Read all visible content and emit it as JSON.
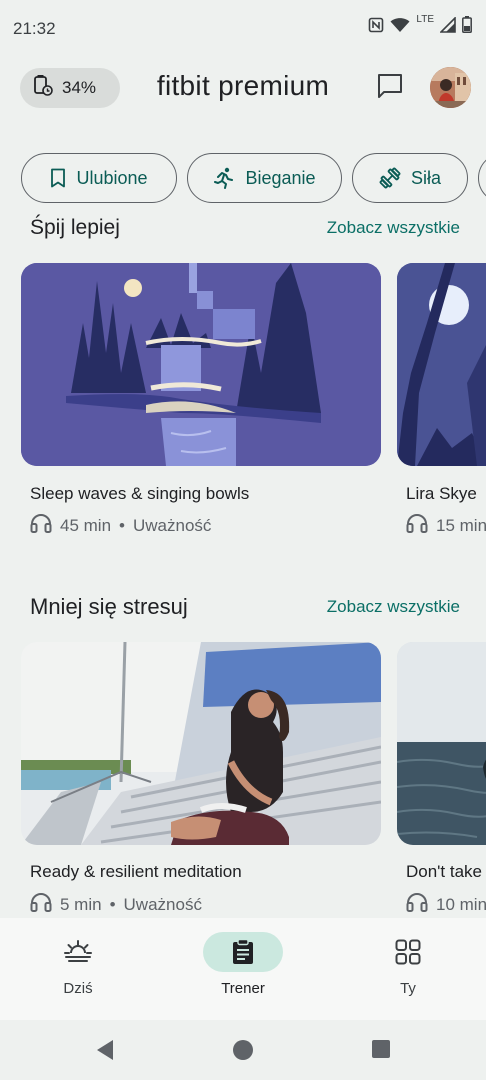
{
  "status_bar": {
    "time": "21:32",
    "network": "LTE",
    "icons": [
      "nfc-icon",
      "wifi-icon",
      "signal-icon",
      "battery-icon"
    ]
  },
  "header": {
    "battery_label": "34%",
    "title": "fitbit premium",
    "icons": [
      "watch-battery-icon",
      "chat-icon",
      "avatar"
    ]
  },
  "chips": [
    {
      "label": "Ulubione",
      "icon": "bookmark-icon"
    },
    {
      "label": "Bieganie",
      "icon": "running-icon"
    },
    {
      "label": "Siła",
      "icon": "dumbbell-icon"
    }
  ],
  "section_sleep": {
    "title": "Śpij lepiej",
    "see_all": "Zobacz wszystkie",
    "cards": [
      {
        "title": "Sleep waves & singing bowls",
        "duration": "45 min",
        "category": "Uważność"
      },
      {
        "title": "Lira Skye",
        "duration": "15 min",
        "category": ""
      }
    ]
  },
  "section_stress": {
    "title": "Mniej się stresuj",
    "see_all": "Zobacz wszystkie",
    "cards": [
      {
        "title": "Ready & resilient meditation",
        "duration": "5 min",
        "category": "Uważność"
      },
      {
        "title": "Don't take",
        "duration": "10 min",
        "category": ""
      }
    ]
  },
  "bottom_nav": {
    "items": [
      {
        "label": "Dziś",
        "icon": "sunrise-icon",
        "active": false
      },
      {
        "label": "Trener",
        "icon": "clipboard-icon",
        "active": true
      },
      {
        "label": "Ty",
        "icon": "grid-icon",
        "active": false
      }
    ]
  },
  "colors": {
    "accent": "#0b6f66",
    "active_pill": "#cbe8df",
    "background": "#eef1ef"
  }
}
